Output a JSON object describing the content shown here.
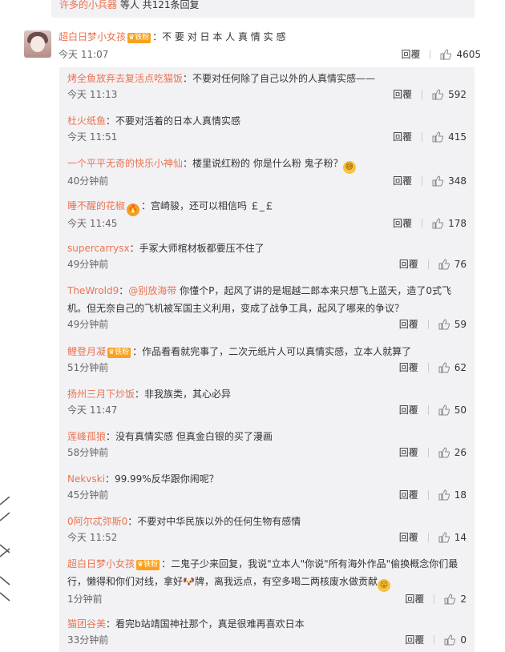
{
  "top": {
    "link": "许多的小兵器",
    "text": " 等人 共121条回复"
  },
  "main_comment": {
    "user": "超白日梦小女孩",
    "badge": "铁粉",
    "text": "：不 要 对 日 本 人 真 情 实 感",
    "time": "今天 11:07",
    "reply_label": "回覆",
    "likes": "4605"
  },
  "replies": [
    {
      "user": "烤全鱼放弃去复活点吃猫饭",
      "text": "：不要对任何除了自己以外的人真情实感——",
      "time": "今天 11:13",
      "reply_label": "回覆",
      "likes": "592"
    },
    {
      "user": "杜火纸鱼",
      "text": "：不要对活着的日本人真情实感",
      "time": "今天 11:51",
      "reply_label": "回覆",
      "likes": "415"
    },
    {
      "user": "一个平平无奇的快乐小神仙",
      "text": "：楼里说红粉的 你是什么粉 鬼子粉？",
      "time": "40分钟前",
      "reply_label": "回覆",
      "likes": "348"
    },
    {
      "user": "睡不醒的花椒",
      "text": "：宫崎骏，还可以相信吗 ￡_￡",
      "time": "今天 11:45",
      "reply_label": "回覆",
      "likes": "178"
    },
    {
      "user": "supercarrysx",
      "text": "：手冢大师棺材板都要压不住了",
      "time": "49分钟前",
      "reply_label": "回覆",
      "likes": "76"
    },
    {
      "user": "TheWrold9",
      "mention": "@别放海带",
      "text": " 你懂个P，起风了讲的是堀越二郎本来只想飞上蓝天，造了0式飞",
      "text2": "机。但无奈自己的飞机被军国主义利用，变成了战争工具，起风了哪来的争议？",
      "time": "49分钟前",
      "reply_label": "回覆",
      "likes": "59"
    },
    {
      "user": "鲤登月凝",
      "badge": "铁粉",
      "text": "：作品看看就完事了，二次元纸片人可以真情实感，立本人就算了",
      "time": "51分钟前",
      "reply_label": "回覆",
      "likes": "62"
    },
    {
      "user": "扬州三月下炒饭",
      "text": "：非我族类，其心必异",
      "time": "今天 11:47",
      "reply_label": "回覆",
      "likes": "50"
    },
    {
      "user": "莲峰孤狼",
      "text": "：没有真情实感 但真金白银的买了漫画",
      "time": "58分钟前",
      "reply_label": "回覆",
      "likes": "26"
    },
    {
      "user": "Nekvski",
      "text": "：99.99%反华跟你闹呢？",
      "time": "45分钟前",
      "reply_label": "回覆",
      "likes": "18"
    },
    {
      "user": "0阿尔忒弥斯0",
      "text": "：不要对中华民族以外的任何生物有感情",
      "time": "今天 11:52",
      "reply_label": "回覆",
      "likes": "14"
    },
    {
      "user": "超白日梦小女孩",
      "badge": "铁粉",
      "text": "：二鬼子少来回复，我说\"立本人\"你说\"所有海外作品\"偷换概念你们最",
      "text2": "行，懒得和你们对线，拿好🐶牌，离我远点，有空多喝二两核废水做贡献",
      "time": "1分钟前",
      "reply_label": "回覆",
      "likes": "2"
    },
    {
      "user": "猫团谷美",
      "text": "：看完b站靖国神社那个，真是很难再喜欢日本",
      "time": "33分钟前",
      "reply_label": "回覆",
      "likes": "0"
    }
  ]
}
